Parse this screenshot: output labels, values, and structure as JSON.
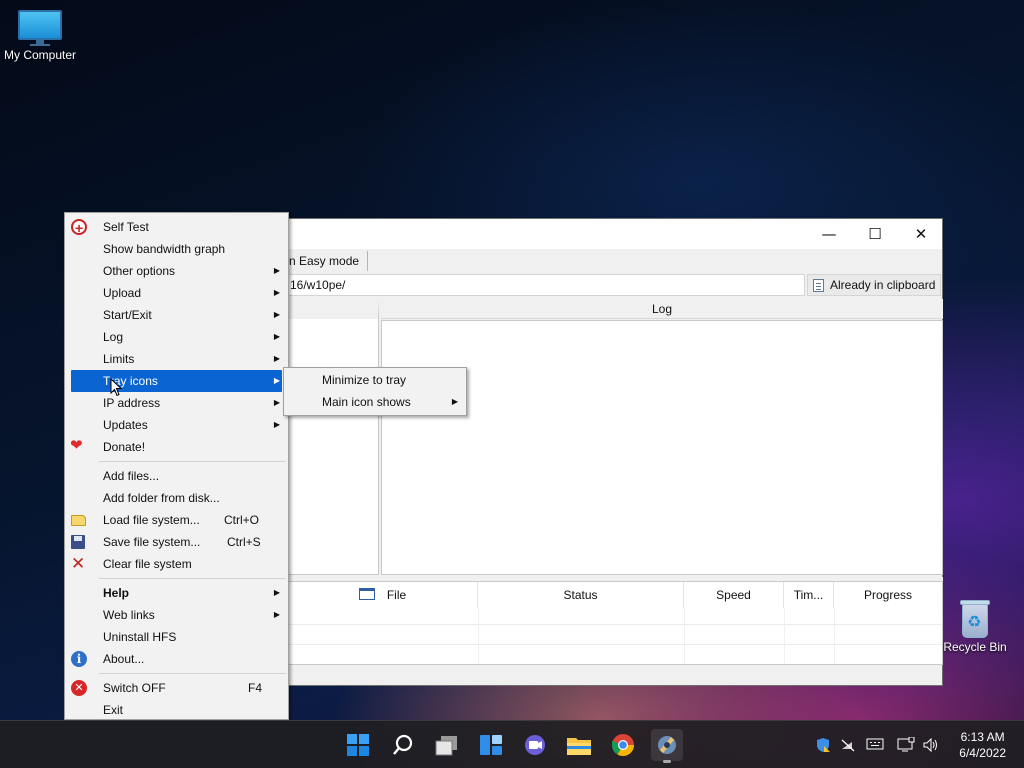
{
  "desktop": {
    "icons": [
      {
        "label": "My Computer"
      },
      {
        "label": "Recycle Bin"
      }
    ]
  },
  "hfs_window": {
    "titlebar": {
      "minimize_glyph": "—",
      "maximize_glyph": "☐",
      "close_glyph": "✕"
    },
    "easy_mode_label": "n Easy mode",
    "url_value": "16/w10pe/",
    "clipboard_button": "Already in clipboard",
    "log_header": "Log",
    "file_table": {
      "columns": [
        "File",
        "Status",
        "Speed",
        "Tim...",
        "Progress"
      ]
    }
  },
  "context_menu": {
    "items": [
      {
        "label": "Self Test",
        "icon": "self-test-icon"
      },
      {
        "label": "Show bandwidth graph"
      },
      {
        "label": "Other options",
        "submenu": true
      },
      {
        "label": "Upload",
        "submenu": true
      },
      {
        "label": "Start/Exit",
        "submenu": true
      },
      {
        "label": "Log",
        "submenu": true
      },
      {
        "label": "Limits",
        "submenu": true
      },
      {
        "label": "Tray icons",
        "submenu": true,
        "selected": true
      },
      {
        "label": "IP address",
        "submenu": true
      },
      {
        "label": "Updates",
        "submenu": true
      },
      {
        "label": "Donate!",
        "icon": "heart-icon"
      },
      {
        "label": "Add files..."
      },
      {
        "label": "Add folder from disk..."
      },
      {
        "label": "Load file system...",
        "shortcut": "Ctrl+O",
        "icon": "folder-open-icon"
      },
      {
        "label": "Save file system...",
        "shortcut": "Ctrl+S",
        "icon": "floppy-disk-icon"
      },
      {
        "label": "Clear file system",
        "icon": "clear-x-icon"
      },
      {
        "label": "Help",
        "submenu": true,
        "bold": true
      },
      {
        "label": "Web links",
        "submenu": true
      },
      {
        "label": "Uninstall HFS"
      },
      {
        "label": "About...",
        "icon": "info-icon"
      },
      {
        "label": "Switch OFF",
        "shortcut": "F4",
        "icon": "switch-off-icon"
      },
      {
        "label": "Exit"
      }
    ],
    "submenu_arrow": "▶"
  },
  "tray_submenu": {
    "items": [
      {
        "label": "Minimize to tray"
      },
      {
        "label": "Main icon shows",
        "submenu": true
      }
    ]
  },
  "taskbar": {
    "apps": [
      "start-button",
      "search",
      "task-view",
      "widgets",
      "chat",
      "file-explorer",
      "chrome",
      "hfs"
    ],
    "clock": {
      "time": "6:13 AM",
      "date": "6/4/2022"
    }
  },
  "colors": {
    "menu_highlight": "#0a64d2",
    "menu_bg": "#f2f2f2"
  }
}
